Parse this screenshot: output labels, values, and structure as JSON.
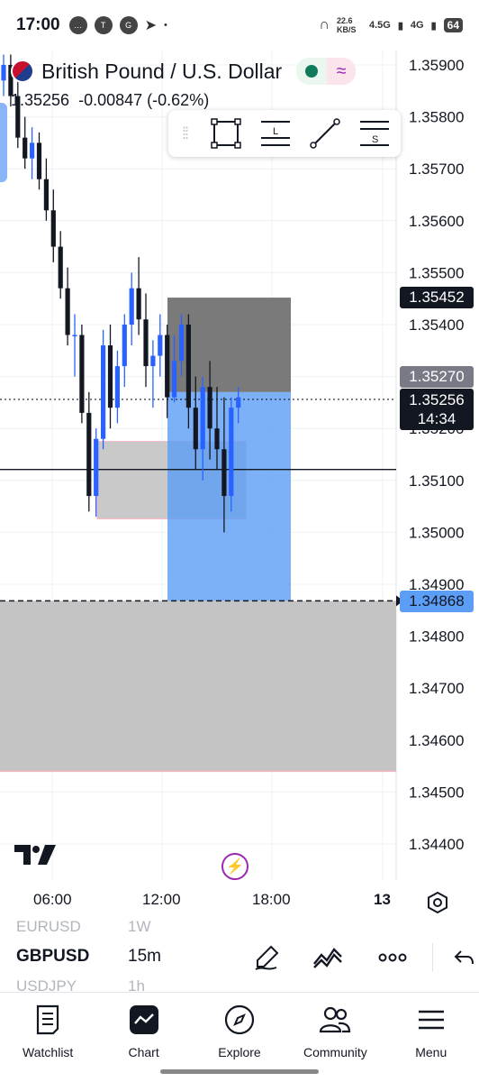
{
  "status_bar": {
    "time": "17:00",
    "net_speed": "22.6 KB/S",
    "net_4_5g": "4.5G",
    "net_4g": "4G",
    "battery": "64"
  },
  "header": {
    "title": "British Pound / U.S. Dollar",
    "last_price": "1.35256",
    "change": "-0.00847",
    "change_pct": "(-0.62%)"
  },
  "drawing_toolbar": {
    "tools": [
      "rectangle-icon",
      "long-position-icon",
      "trend-line-icon",
      "short-position-icon"
    ],
    "long_glyph": "L",
    "short_glyph": "S"
  },
  "price_axis": {
    "ticks": [
      "1.35900",
      "1.35800",
      "1.35700",
      "1.35600",
      "1.35500",
      "1.35400",
      "1.35200",
      "1.35100",
      "1.35000",
      "1.34900",
      "1.34800",
      "1.34700",
      "1.34600",
      "1.34500",
      "1.34400"
    ],
    "labels": {
      "target": "1.35452",
      "entry": "1.35270",
      "current_price": "1.35256",
      "countdown": "14:34",
      "stop": "1.34868"
    }
  },
  "time_axis": {
    "ticks": [
      "06:00",
      "12:00",
      "18:00",
      "13"
    ]
  },
  "symbols": {
    "prev_symbol": "EURUSD",
    "prev_timeframe": "1W",
    "current_symbol": "GBPUSD",
    "current_timeframe": "15m",
    "next_symbol": "USDJPY",
    "next_timeframe": "1h"
  },
  "bottom_nav": [
    {
      "label": "Watchlist",
      "icon": "watchlist-icon"
    },
    {
      "label": "Chart",
      "icon": "chart-icon"
    },
    {
      "label": "Explore",
      "icon": "compass-icon"
    },
    {
      "label": "Community",
      "icon": "community-icon"
    },
    {
      "label": "Menu",
      "icon": "menu-icon"
    }
  ],
  "colors": {
    "bull": "#2962ff",
    "bear": "#131722",
    "target_zone": "#6b6b6b",
    "stop_zone": "#5c9ef5",
    "accent": "#9c27b0"
  },
  "chart_data": {
    "type": "candlestick",
    "x_ticks": [
      "06:00",
      "12:00",
      "18:00",
      "13"
    ],
    "y_range": [
      1.3435,
      1.3592
    ],
    "candles": [
      [
        1.3587,
        1.3592,
        1.3584,
        1.359
      ],
      [
        1.359,
        1.3592,
        1.3582,
        1.3584
      ],
      [
        1.3584,
        1.3588,
        1.3574,
        1.3576
      ],
      [
        1.3576,
        1.358,
        1.357,
        1.3572
      ],
      [
        1.3572,
        1.3578,
        1.3568,
        1.3575
      ],
      [
        1.3575,
        1.3577,
        1.3566,
        1.3568
      ],
      [
        1.3568,
        1.3572,
        1.356,
        1.3562
      ],
      [
        1.3562,
        1.3566,
        1.3552,
        1.3555
      ],
      [
        1.3555,
        1.3558,
        1.3545,
        1.3547
      ],
      [
        1.3547,
        1.3551,
        1.3536,
        1.3538
      ],
      [
        1.3538,
        1.3542,
        1.353,
        1.3538
      ],
      [
        1.3538,
        1.354,
        1.3521,
        1.3523
      ],
      [
        1.3523,
        1.3527,
        1.3504,
        1.3507
      ],
      [
        1.3507,
        1.352,
        1.3503,
        1.3518
      ],
      [
        1.3518,
        1.3539,
        1.3516,
        1.3536
      ],
      [
        1.3536,
        1.354,
        1.352,
        1.3524
      ],
      [
        1.3524,
        1.3535,
        1.3521,
        1.3532
      ],
      [
        1.3532,
        1.3542,
        1.3528,
        1.354
      ],
      [
        1.354,
        1.355,
        1.3536,
        1.3547
      ],
      [
        1.3547,
        1.3553,
        1.3538,
        1.3541
      ],
      [
        1.3541,
        1.3546,
        1.3528,
        1.3532
      ],
      [
        1.3532,
        1.3537,
        1.3524,
        1.3534
      ],
      [
        1.3534,
        1.3542,
        1.353,
        1.3538
      ],
      [
        1.3538,
        1.354,
        1.3522,
        1.3526
      ],
      [
        1.3526,
        1.3538,
        1.3525,
        1.3533
      ],
      [
        1.3533,
        1.3542,
        1.353,
        1.354
      ],
      [
        1.354,
        1.3542,
        1.352,
        1.3524
      ],
      [
        1.3524,
        1.353,
        1.3512,
        1.3516
      ],
      [
        1.3516,
        1.353,
        1.351,
        1.3528
      ],
      [
        1.3528,
        1.3533,
        1.3514,
        1.352
      ],
      [
        1.352,
        1.3528,
        1.3512,
        1.3516
      ],
      [
        1.3516,
        1.3526,
        1.35,
        1.3507
      ],
      [
        1.3507,
        1.3526,
        1.3504,
        1.3524
      ],
      [
        1.3524,
        1.3528,
        1.3521,
        1.3526
      ]
    ]
  }
}
